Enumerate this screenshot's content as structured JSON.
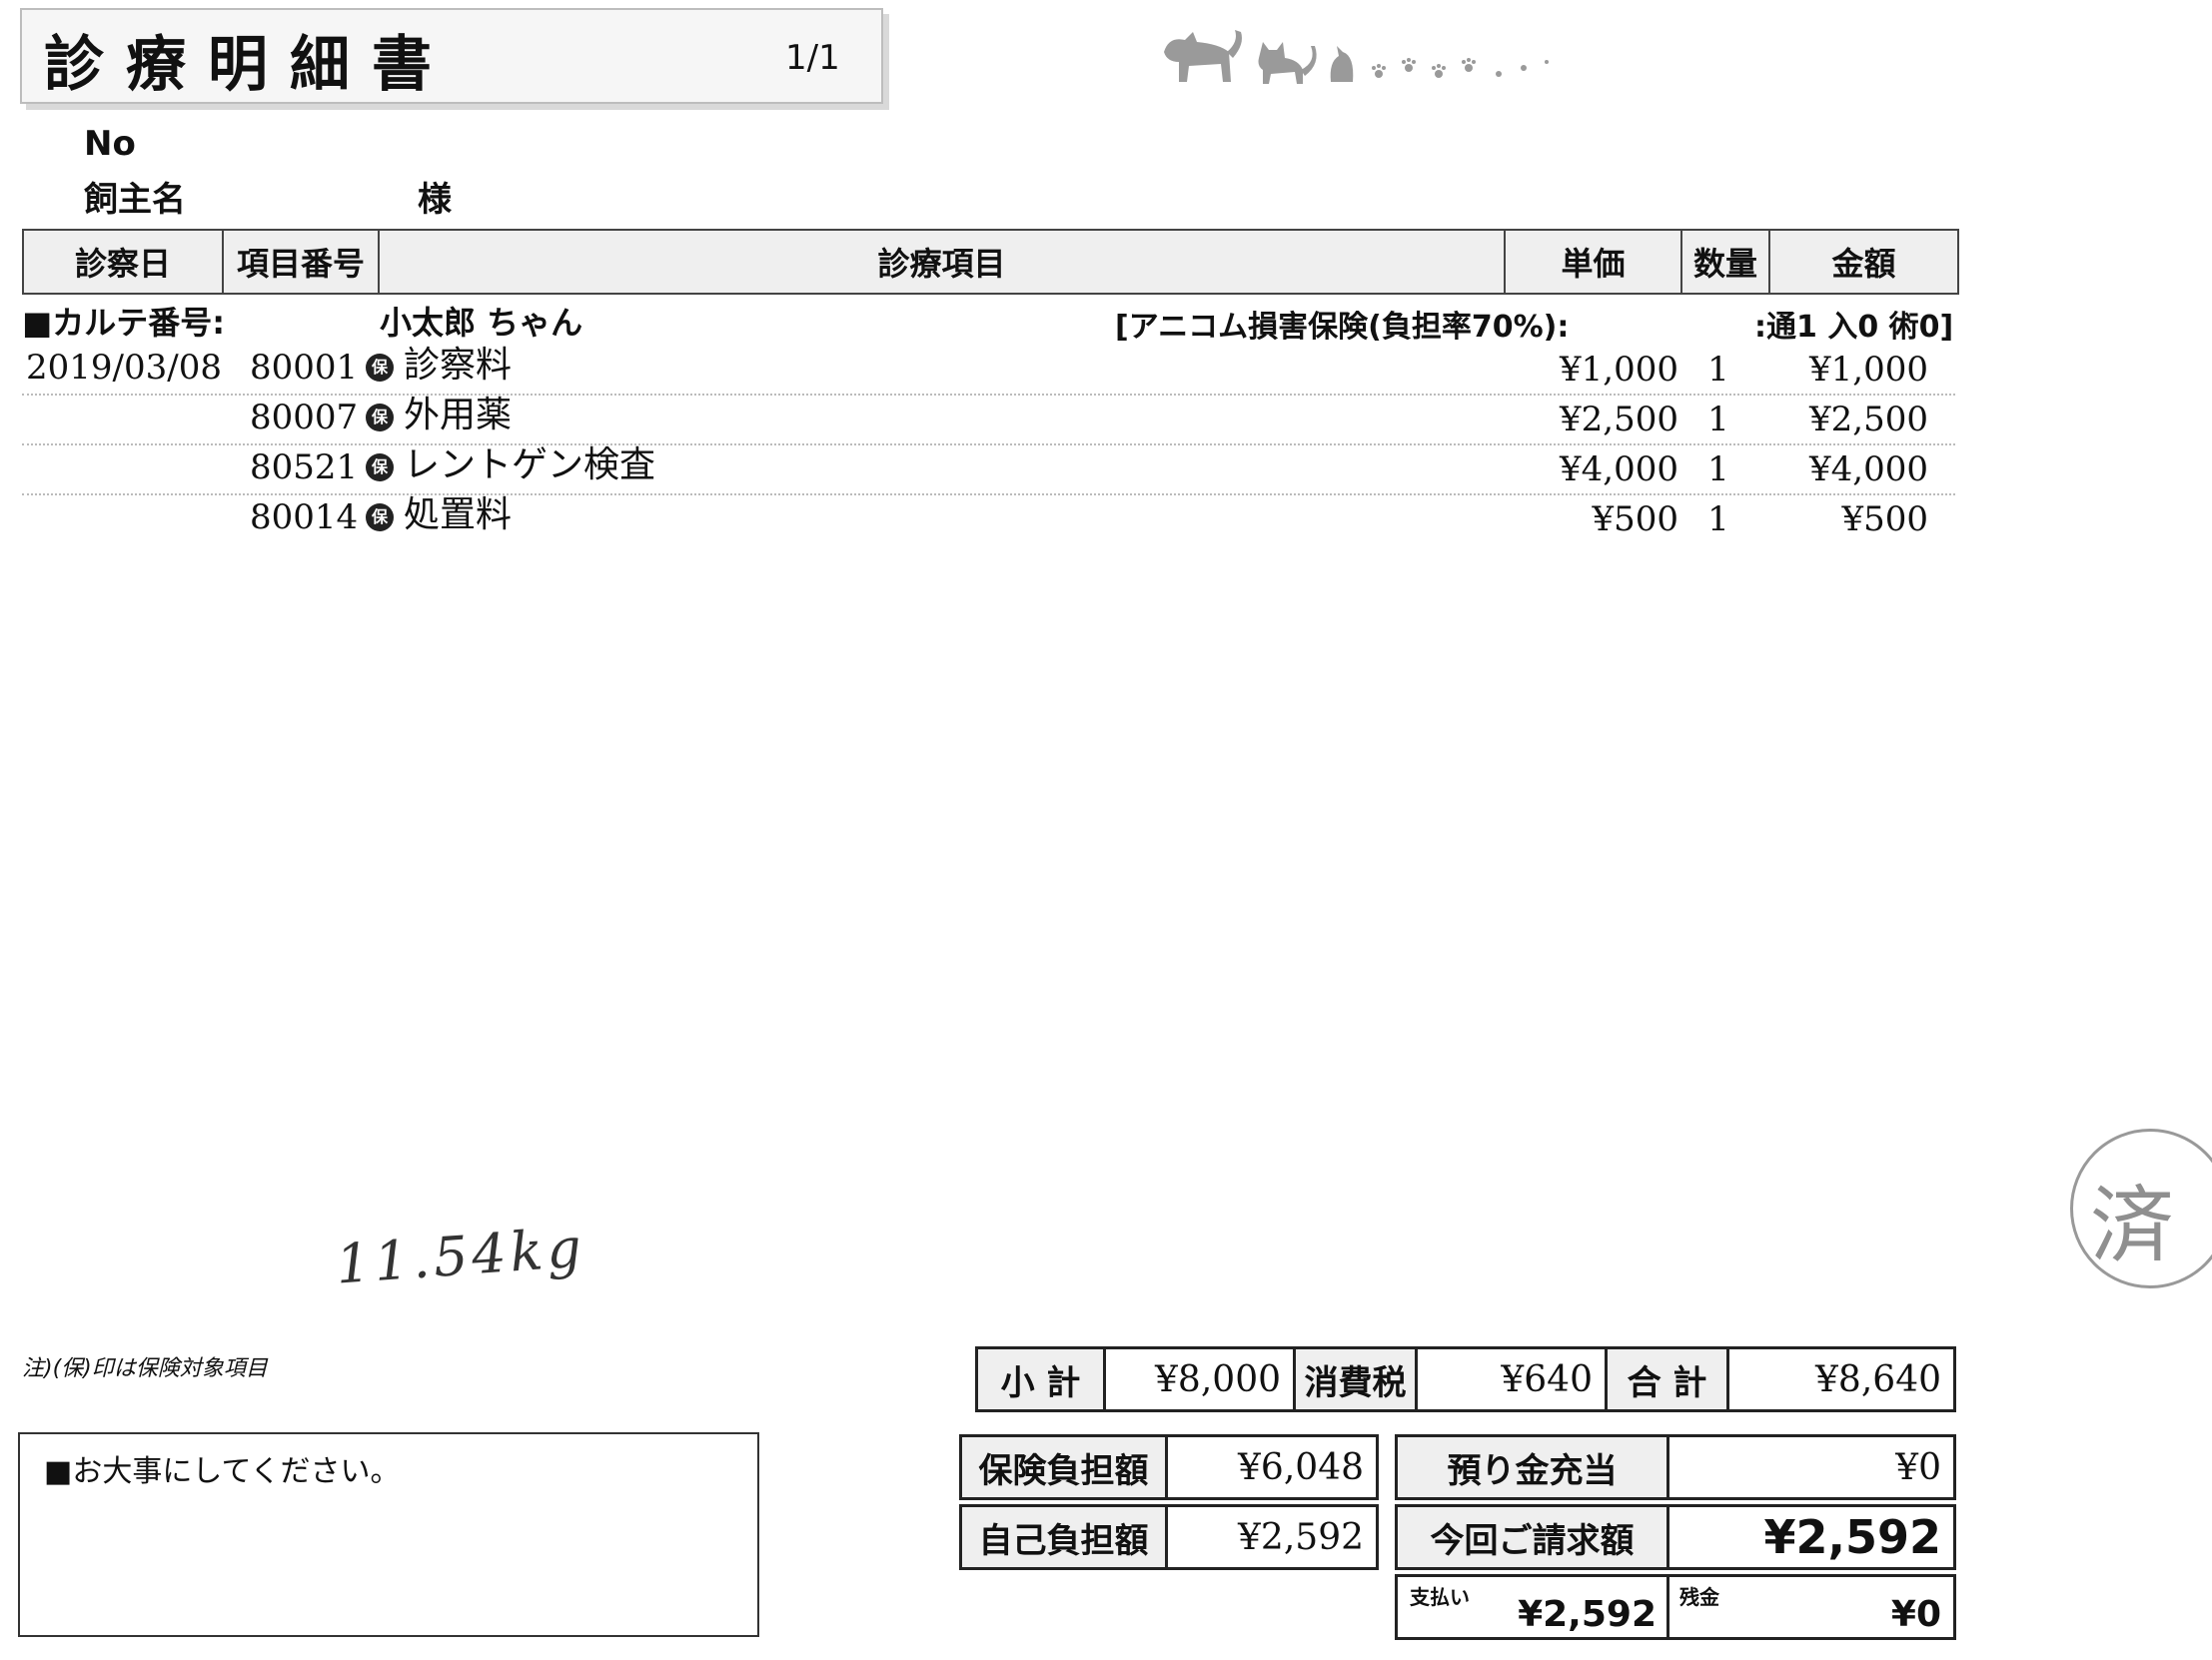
{
  "title": "診療明細書",
  "page": "1/1",
  "header": {
    "no_label": "No",
    "owner_label": "飼主名",
    "owner_suffix": "様"
  },
  "columns": [
    "診察日",
    "項目番号",
    "診療項目",
    "単価",
    "数量",
    "金額"
  ],
  "chart": {
    "label": "■カルテ番号:",
    "pet_name": "小太郎 ちゃん",
    "insurance": "[アニコム損害保険(負担率70%):",
    "visits": ":通1 入0 術0]"
  },
  "items": [
    {
      "date": "2019/03/08",
      "code": "80001",
      "mark": "保",
      "name": "診察料",
      "unit_price": "¥1,000",
      "qty": "1",
      "amount": "¥1,000"
    },
    {
      "date": "",
      "code": "80007",
      "mark": "保",
      "name": "外用薬",
      "unit_price": "¥2,500",
      "qty": "1",
      "amount": "¥2,500"
    },
    {
      "date": "",
      "code": "80521",
      "mark": "保",
      "name": "レントゲン検査",
      "unit_price": "¥4,000",
      "qty": "1",
      "amount": "¥4,000"
    },
    {
      "date": "",
      "code": "80014",
      "mark": "保",
      "name": "処置料",
      "unit_price": "¥500",
      "qty": "1",
      "amount": "¥500"
    }
  ],
  "handwritten_weight": "11.54kg",
  "note": "注)(保)印は保険対象項目",
  "message": "■お大事にしてください。",
  "totals": {
    "subtotal_label": "小 計",
    "subtotal": "¥8,000",
    "tax_label": "消費税",
    "tax": "¥640",
    "total_label": "合 計",
    "total": "¥8,640",
    "insurance_label": "保険負担額",
    "insurance": "¥6,048",
    "self_label": "自己負担額",
    "self": "¥2,592",
    "deposit_label": "預り金充当",
    "deposit": "¥0",
    "billing_label": "今回ご請求額",
    "billing": "¥2,592",
    "paid_label": "支払い",
    "paid": "¥2,592",
    "balance_label": "残金",
    "balance": "¥0"
  },
  "stamp_text": "済"
}
